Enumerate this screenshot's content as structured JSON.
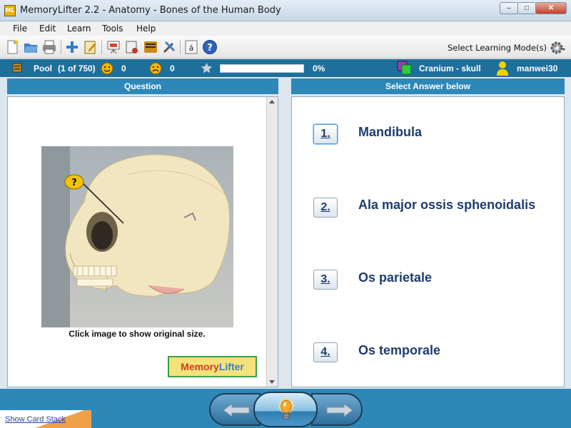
{
  "window": {
    "title": "MemoryLifter 2.2 - Anatomy - Bones of the Human Body",
    "app_icon_text": "ML",
    "min": "–",
    "max": "□",
    "close": "✕"
  },
  "menu": [
    "File",
    "Edit",
    "Learn",
    "Tools",
    "Help"
  ],
  "toolbar": {
    "select_mode_label": "Select Learning Mode(s)",
    "icons": [
      "new-icon",
      "open-icon",
      "print-icon",
      "add-icon",
      "edit-icon",
      "slideshow-icon",
      "card-icon",
      "notes-icon",
      "settings-tools-icon",
      "special-chars-icon",
      "help-icon",
      "gear-icon"
    ]
  },
  "status": {
    "pool_label": "Pool",
    "pool_count": "(1 of 750)",
    "correct_count": "0",
    "wrong_count": "0",
    "progress_text": "0%",
    "progress_fraction": 0.0,
    "chapter": "Cranium - skull",
    "user": "manwei30"
  },
  "question": {
    "header": "Question",
    "image_marker": "?",
    "caption": "Click image to show original size.",
    "logo_part1": "Memory",
    "logo_part2": "Lifter"
  },
  "answers": {
    "header": "Select Answer below",
    "items": [
      {
        "number": "1.",
        "text": "Mandibula"
      },
      {
        "number": "2.",
        "text": "Ala major ossis sphenoidalis"
      },
      {
        "number": "3.",
        "text": "Os parietale"
      },
      {
        "number": "4.",
        "text": "Os temporale"
      }
    ]
  },
  "footer": {
    "show_card_stack": "Show Card Stack"
  },
  "colors": {
    "accent": "#2d88b8",
    "status_bar": "#1f6f9b",
    "answer_text": "#1e3c6e"
  }
}
